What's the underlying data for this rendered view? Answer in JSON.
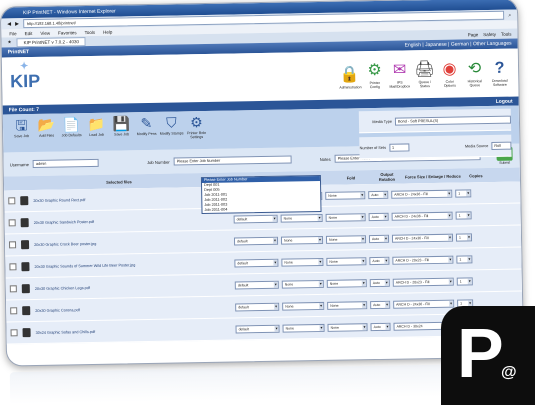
{
  "browser": {
    "title": "KIP PrintNET - Windows Internet Explorer",
    "address": "http://192.168.1.48/printnet/",
    "menu": [
      "File",
      "Edit",
      "View",
      "Favorites",
      "Tools",
      "Help"
    ],
    "tab": "KIP PrintNET v 7.0.2 - 4030",
    "tab_actions": [
      "Page",
      "Safety",
      "Tools"
    ]
  },
  "app": {
    "name": "PrintNET",
    "language_links": "English | Japanese | German | Other Languages",
    "logo": "KIP",
    "tools": [
      {
        "label": "Administration",
        "icon": "lock-icon",
        "glyph": "🔒"
      },
      {
        "label": "Printer Config",
        "icon": "gears-icon",
        "glyph": "⚙"
      },
      {
        "label": "IPS Mail/Dropbox",
        "icon": "mail-icon",
        "glyph": "✉"
      },
      {
        "label": "Queue / Status",
        "icon": "queue-icon",
        "glyph": "🖨"
      },
      {
        "label": "Color Options",
        "icon": "color-wheel-icon",
        "glyph": "◉"
      },
      {
        "label": "Historical Queue",
        "icon": "history-icon",
        "glyph": "⟲"
      },
      {
        "label": "Download Software",
        "icon": "help-icon",
        "glyph": "?"
      }
    ],
    "file_count": "File Count: 7",
    "logout": "Logout"
  },
  "toolbar": {
    "items": [
      {
        "label": "Save Job",
        "icon": "save-job-icon",
        "glyph": "🖫"
      },
      {
        "label": "Add Files",
        "icon": "add-files-icon",
        "glyph": "📂"
      },
      {
        "label": "Job Defaults",
        "icon": "job-defaults-icon",
        "glyph": "📄"
      },
      {
        "label": "Load Job",
        "icon": "load-job-icon",
        "glyph": "📁"
      },
      {
        "label": "Save Job",
        "icon": "save-icon",
        "glyph": "💾"
      },
      {
        "label": "Modify Pens",
        "icon": "pen-icon",
        "glyph": "✎"
      },
      {
        "label": "Modify Stamps",
        "icon": "stamp-icon",
        "glyph": "⛉"
      },
      {
        "label": "Printer Role Settings",
        "icon": "settings-icon",
        "glyph": "⚙"
      }
    ],
    "media_type_label": "Media Type",
    "media_type_value": "Bond - Soft PRESUL(S)",
    "number_of_sets_label": "Number of Sets",
    "number_of_sets_value": "1",
    "media_source_label": "Media Source",
    "media_source_value": "Roll"
  },
  "form": {
    "username_label": "Username",
    "username_value": "admin",
    "job_number_label": "Job Number",
    "job_number_value": "Please Enter Job Number",
    "notes_label": "Notes",
    "notes_value": "Please Enter Notes",
    "submit_label": "Submit"
  },
  "job_dropdown": {
    "options": [
      "Please Enter Job Number",
      "Dept 001",
      "Dept 005",
      "Job 2011-001",
      "Job 2011-002",
      "Job 2011-003",
      "Job 2011-004"
    ],
    "selected_index": 0
  },
  "table": {
    "headers": [
      "Selected files",
      "Size",
      "Stamp",
      "Fold",
      "Output Rotation",
      "Force Size / Enlarge / Reduce",
      "Copies"
    ],
    "rows": [
      {
        "name": "20x30 Graphic Round Rect.pdf",
        "size": "default",
        "stamp": "None",
        "fold": "None",
        "rotation": "Auto",
        "force": "ARCH D - 24x36 - Fill",
        "copies": "1"
      },
      {
        "name": "20x30 Graphic Sandwich Poster.pdf",
        "size": "default",
        "stamp": "None",
        "fold": "None",
        "rotation": "Auto",
        "force": "ARCH D - 24x36 - Fill",
        "copies": "1"
      },
      {
        "name": "20x30 Graphic Crock Beer poster.jpg",
        "size": "default",
        "stamp": "None",
        "fold": "None",
        "rotation": "Auto",
        "force": "ARCH D - 24x36 - Fill",
        "copies": "1"
      },
      {
        "name": "20x30 Graphic Sounds of Summer Wild Life Beer Poster.jpg",
        "size": "default",
        "stamp": "None",
        "fold": "None",
        "rotation": "Auto",
        "force": "ARCH D - 20x23 - Fill",
        "copies": "1"
      },
      {
        "name": "20x30 Graphic Chicken Legs.pdf",
        "size": "default",
        "stamp": "None",
        "fold": "None",
        "rotation": "Auto",
        "force": "ARCH D - 20x23 - Fill",
        "copies": "1"
      },
      {
        "name": "20x30 Graphic Corona.pdf",
        "size": "default",
        "stamp": "None",
        "fold": "None",
        "rotation": "Auto",
        "force": "ARCH D - 24x36 - Fill",
        "copies": "1"
      },
      {
        "name": "30x24 Graphic Sofas and Chills.pdf",
        "size": "default",
        "stamp": "None",
        "fold": "None",
        "rotation": "Auto",
        "force": "ARCH D - 30x24",
        "copies": "1"
      }
    ]
  },
  "badge": {
    "letter": "P",
    "at": "@"
  },
  "colors": {
    "accent": "#2b5597",
    "toolbar": "#bcd1ec",
    "row": "#e6edf8"
  }
}
